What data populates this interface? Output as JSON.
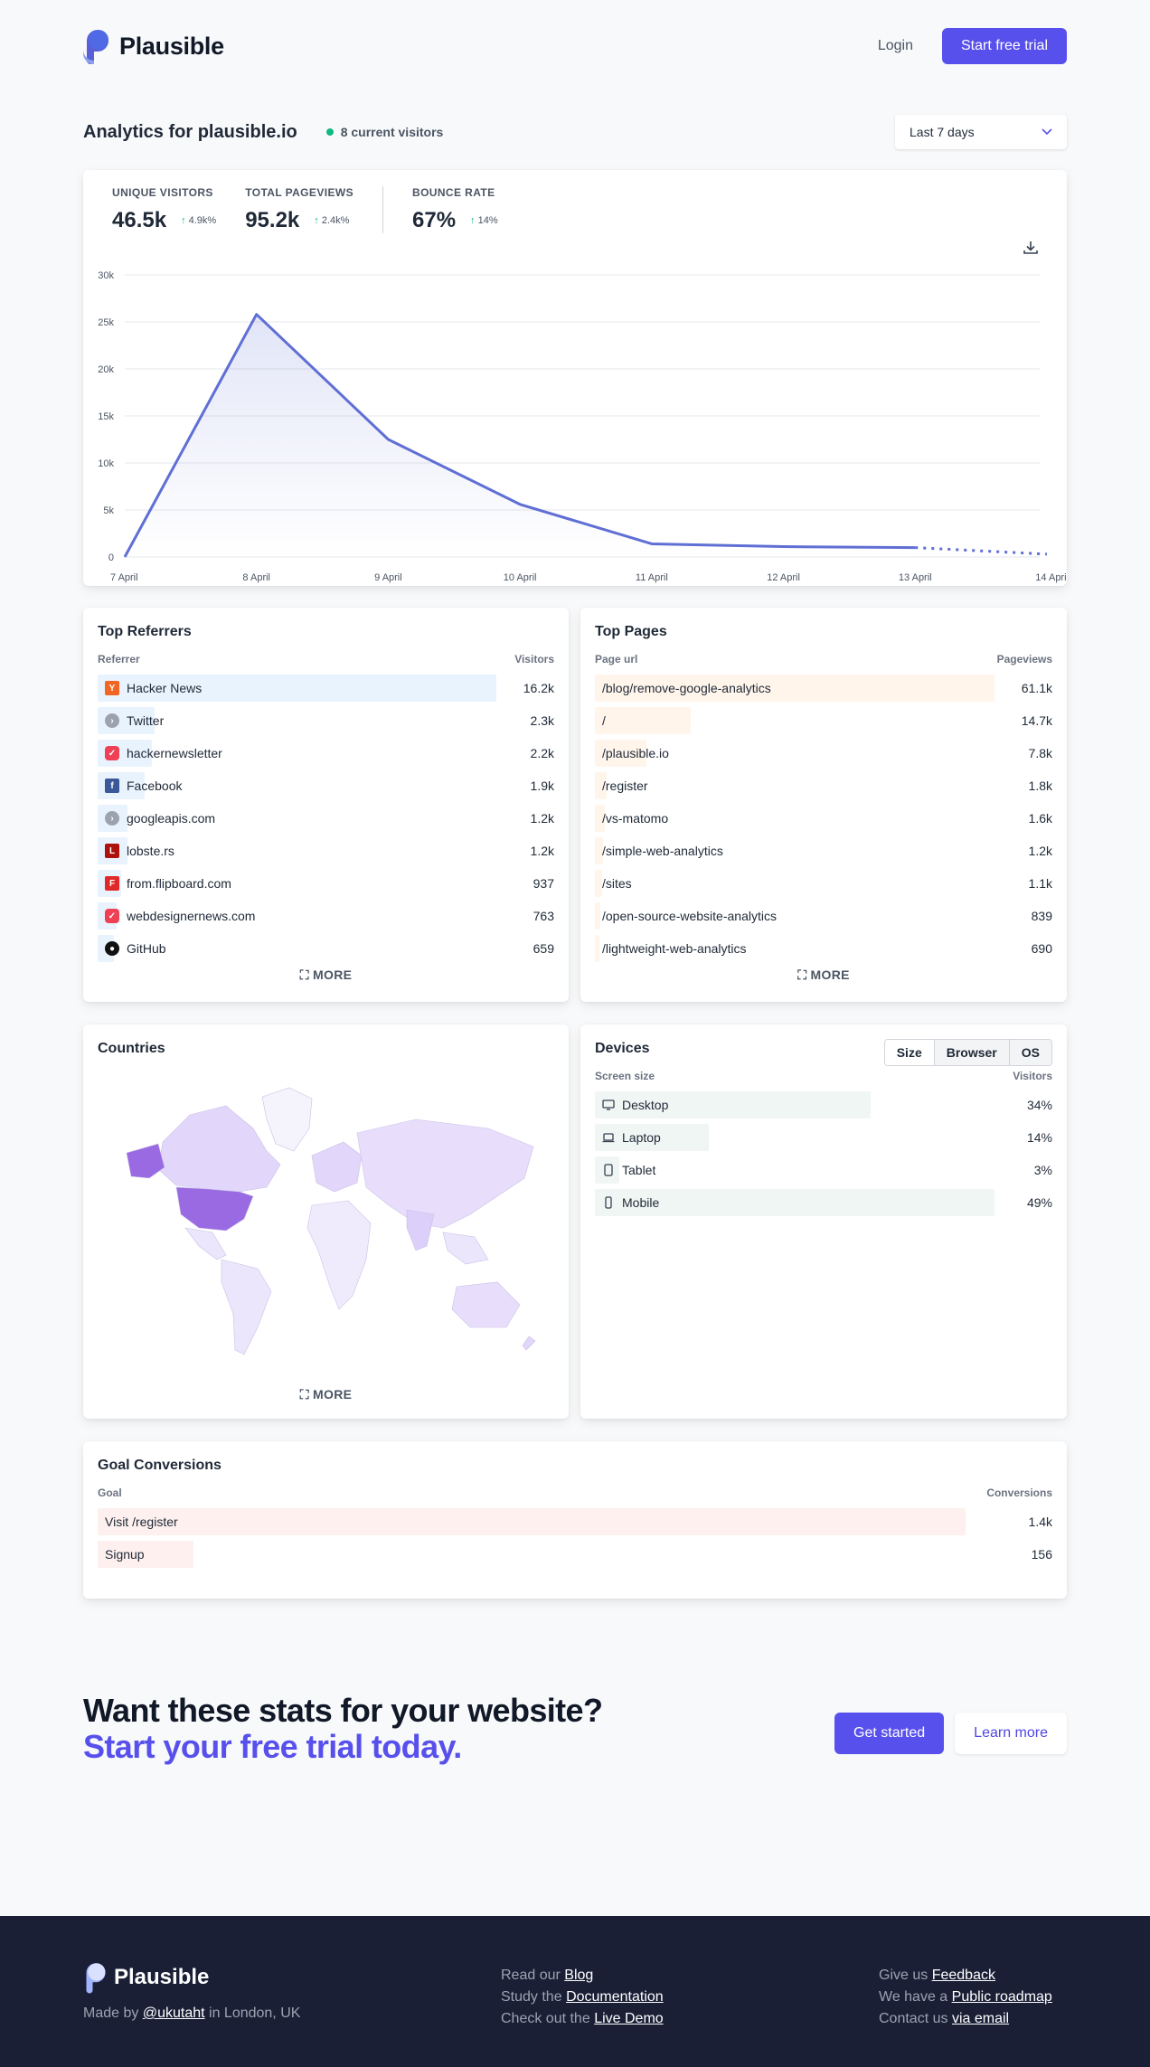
{
  "header": {
    "brand": "Plausible",
    "login": "Login",
    "trial": "Start free trial"
  },
  "analytics": {
    "title": "Analytics for plausible.io",
    "current_visitors": "8 current visitors",
    "period": "Last 7 days"
  },
  "stats": [
    {
      "label": "UNIQUE VISITORS",
      "value": "46.5k",
      "change": "4.9k%"
    },
    {
      "label": "TOTAL PAGEVIEWS",
      "value": "95.2k",
      "change": "2.4k%"
    },
    {
      "label": "BOUNCE RATE",
      "value": "67%",
      "change": "14%"
    }
  ],
  "chart_data": {
    "type": "line",
    "x": [
      "7 April",
      "8 April",
      "9 April",
      "10 April",
      "11 April",
      "12 April",
      "13 April",
      "14 April"
    ],
    "series": [
      {
        "values": [
          0,
          25800,
          12500,
          5600,
          1400,
          1100,
          1000,
          300
        ]
      }
    ],
    "ylim": [
      0,
      30000
    ],
    "yticks": [
      "0",
      "5k",
      "10k",
      "15k",
      "20k",
      "25k",
      "30k"
    ],
    "dashed_last_segment": true,
    "grid": true,
    "color": "#5f6fd4"
  },
  "referrers": {
    "title": "Top Referrers",
    "col_label": "Referrer",
    "col_value": "Visitors",
    "more": "MORE",
    "bar_color": "#e8f3fe",
    "rows": [
      {
        "label": "Hacker News",
        "value": "16.2k",
        "pct": 1.0,
        "icon": "hn"
      },
      {
        "label": "Twitter",
        "value": "2.3k",
        "pct": 0.142,
        "icon": "generic"
      },
      {
        "label": "hackernewsletter",
        "value": "2.2k",
        "pct": 0.136,
        "icon": "pocket"
      },
      {
        "label": "Facebook",
        "value": "1.9k",
        "pct": 0.117,
        "icon": "facebook"
      },
      {
        "label": "googleapis.com",
        "value": "1.2k",
        "pct": 0.074,
        "icon": "generic"
      },
      {
        "label": "lobste.rs",
        "value": "1.2k",
        "pct": 0.074,
        "icon": "lobsters"
      },
      {
        "label": "from.flipboard.com",
        "value": "937",
        "pct": 0.058,
        "icon": "flipboard"
      },
      {
        "label": "webdesignernews.com",
        "value": "763",
        "pct": 0.047,
        "icon": "pocket"
      },
      {
        "label": "GitHub",
        "value": "659",
        "pct": 0.041,
        "icon": "github"
      }
    ]
  },
  "pages": {
    "title": "Top Pages",
    "col_label": "Page url",
    "col_value": "Pageviews",
    "more": "MORE",
    "bar_color": "#fff5eb",
    "rows": [
      {
        "label": "/blog/remove-google-analytics",
        "value": "61.1k",
        "pct": 1.0
      },
      {
        "label": "/",
        "value": "14.7k",
        "pct": 0.24
      },
      {
        "label": "/plausible.io",
        "value": "7.8k",
        "pct": 0.128
      },
      {
        "label": "/register",
        "value": "1.8k",
        "pct": 0.03
      },
      {
        "label": "/vs-matomo",
        "value": "1.6k",
        "pct": 0.026
      },
      {
        "label": "/simple-web-analytics",
        "value": "1.2k",
        "pct": 0.02
      },
      {
        "label": "/sites",
        "value": "1.1k",
        "pct": 0.018
      },
      {
        "label": "/open-source-website-analytics",
        "value": "839",
        "pct": 0.014
      },
      {
        "label": "/lightweight-web-analytics",
        "value": "690",
        "pct": 0.011
      }
    ]
  },
  "countries": {
    "title": "Countries",
    "more": "MORE"
  },
  "devices": {
    "title": "Devices",
    "tabs": [
      "Size",
      "Browser",
      "OS"
    ],
    "active_tab": "Size",
    "col_label": "Screen size",
    "col_value": "Visitors",
    "bar_color": "#f0f6f4",
    "rows": [
      {
        "label": "Desktop",
        "value": "34%",
        "pct": 0.69,
        "icon": "desktop"
      },
      {
        "label": "Laptop",
        "value": "14%",
        "pct": 0.286,
        "icon": "laptop"
      },
      {
        "label": "Tablet",
        "value": "3%",
        "pct": 0.061,
        "icon": "tablet"
      },
      {
        "label": "Mobile",
        "value": "49%",
        "pct": 1.0,
        "icon": "mobile"
      }
    ]
  },
  "goals": {
    "title": "Goal Conversions",
    "col_label": "Goal",
    "col_value": "Conversions",
    "bar_color": "#fdf0ee",
    "rows": [
      {
        "label": "Visit /register",
        "value": "1.4k",
        "pct": 1.0
      },
      {
        "label": "Signup",
        "value": "156",
        "pct": 0.11
      }
    ]
  },
  "cta": {
    "line1": "Want these stats for your website?",
    "line2": "Start your free trial today.",
    "primary": "Get started",
    "secondary": "Learn more"
  },
  "footer": {
    "brand": "Plausible",
    "made_by_prefix": "Made by",
    "made_by_link": "@ukutaht",
    "made_by_suffix": "in London, UK",
    "blog_prefix": "Read our",
    "blog": "Blog",
    "docs_prefix": "Study the",
    "docs": "Documentation",
    "demo_prefix": "Check out the",
    "demo": "Live Demo",
    "feedback_prefix": "Give us",
    "feedback": "Feedback",
    "roadmap_prefix": "We have a",
    "roadmap": "Public roadmap",
    "contact_prefix": "Contact us",
    "contact": "via email"
  }
}
